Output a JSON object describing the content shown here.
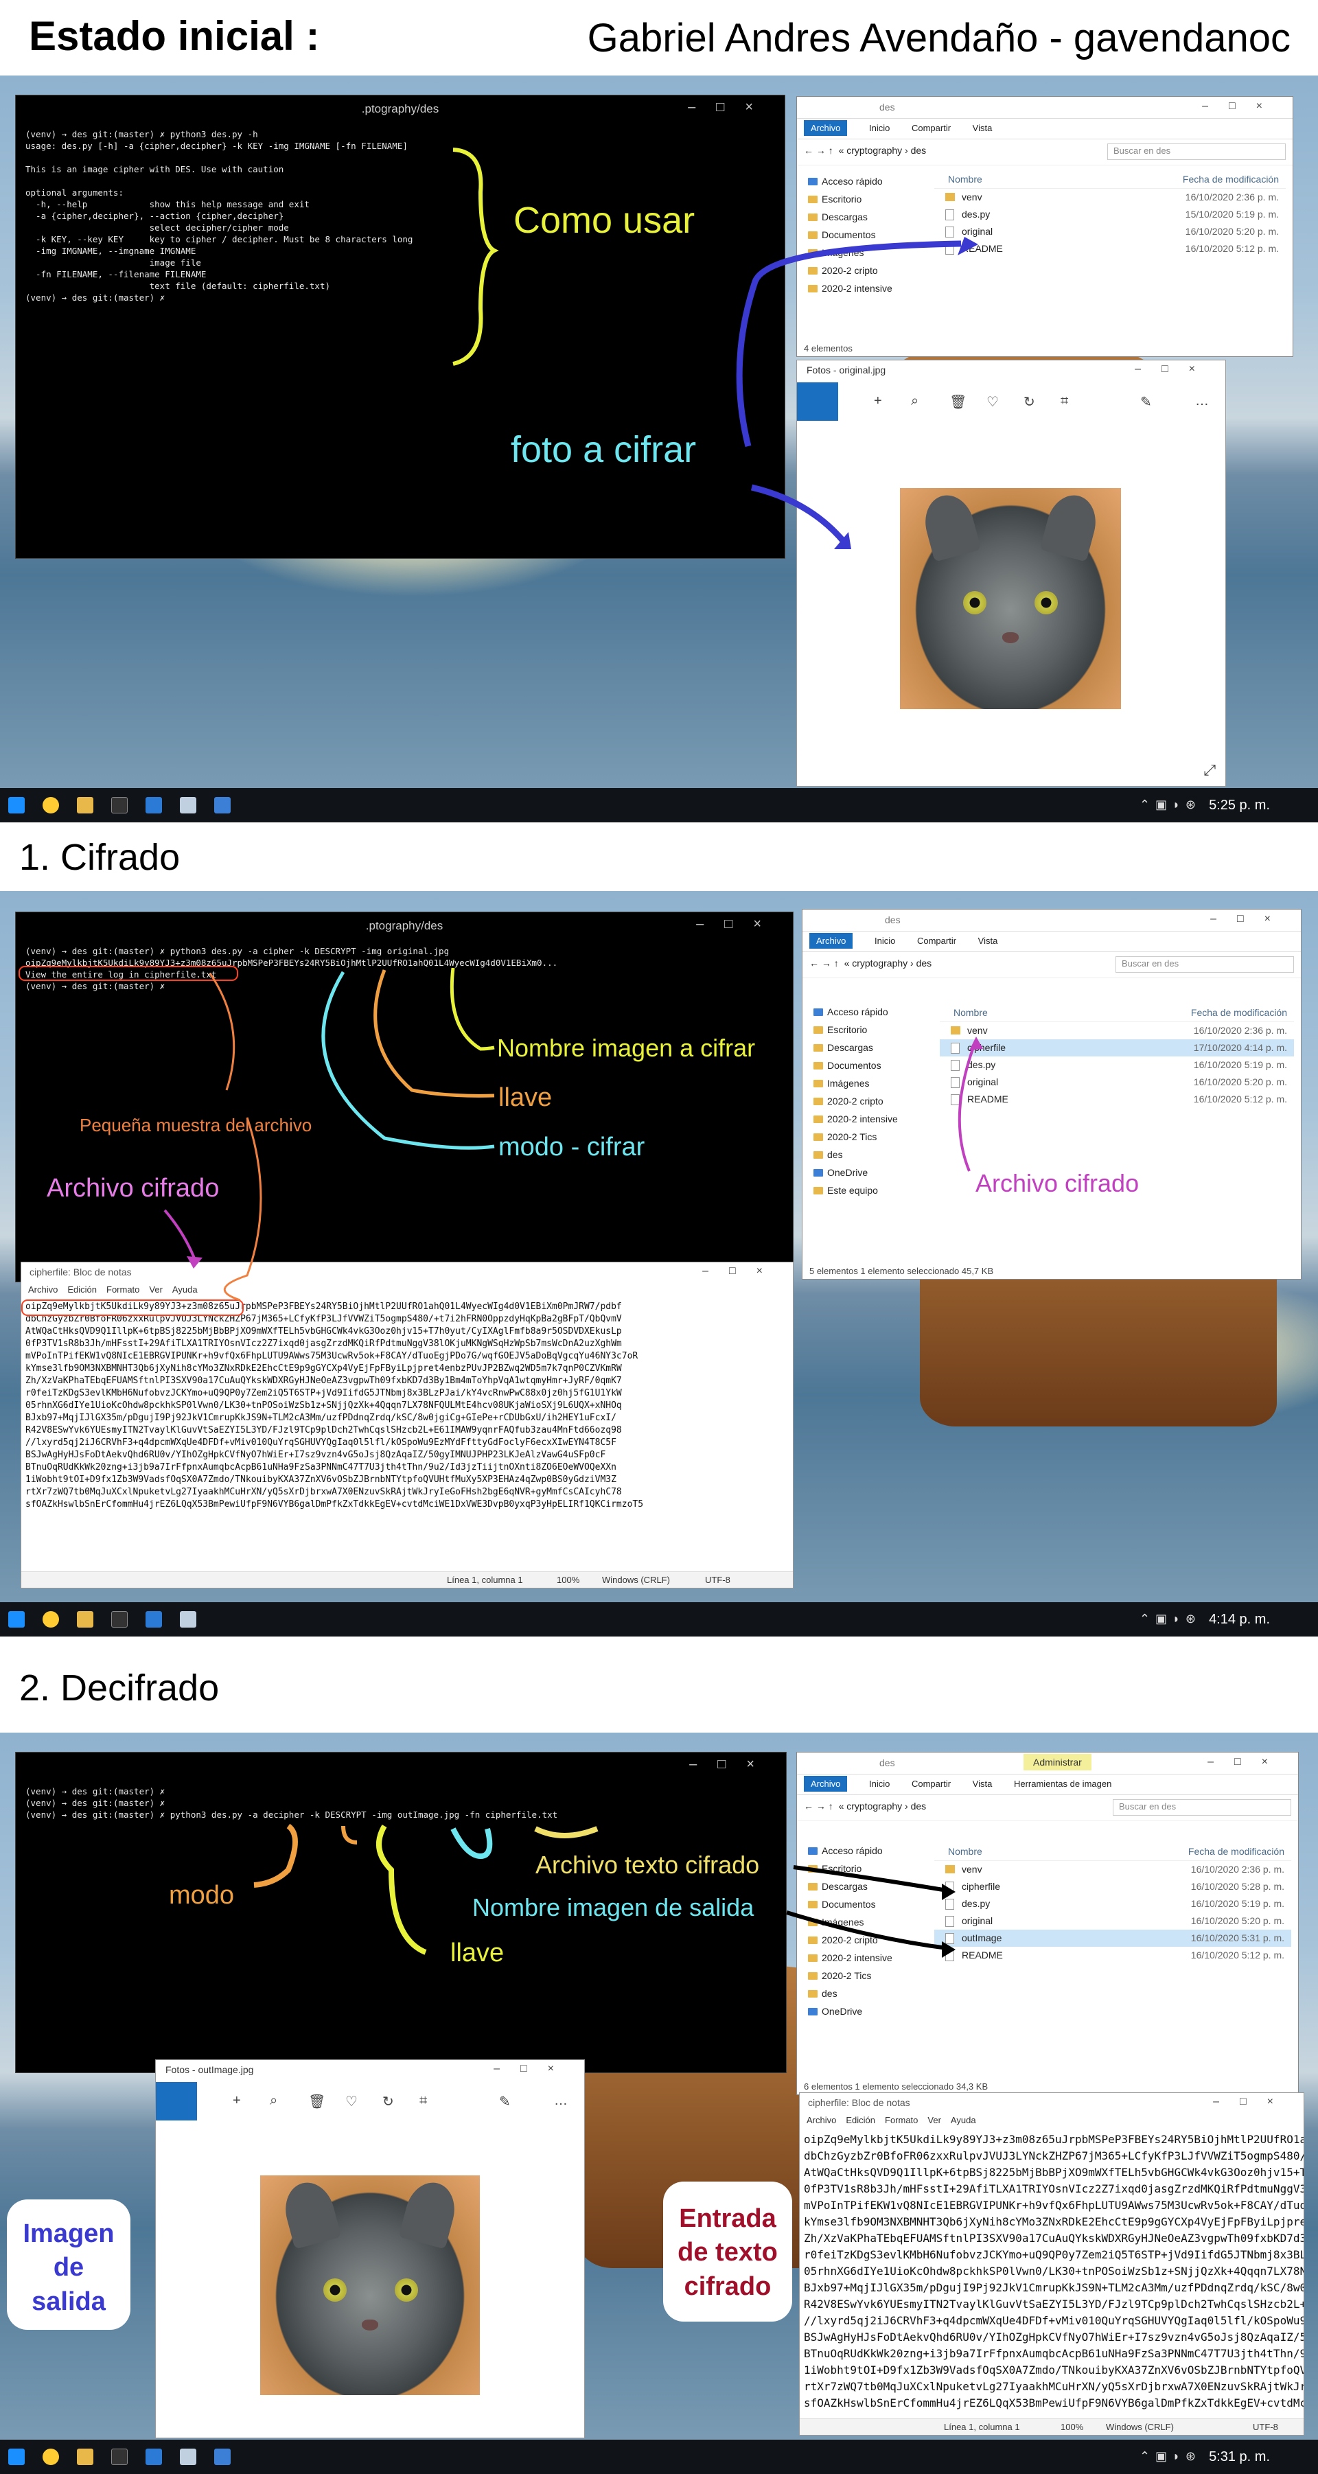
{
  "header": {
    "title": "Estado inicial :",
    "author": "Gabriel Andres Avendaño - gavendanoc"
  },
  "sections": {
    "s1": "1. Cifrado",
    "s2": "2. Decifrado"
  },
  "terminal": {
    "title": ".ptography/des"
  },
  "term1": {
    "l1": "(venv) → des git:(master) ✗ python3 des.py -h",
    "l2": "usage: des.py [-h] -a {cipher,decipher} -k KEY -img IMGNAME [-fn FILENAME]",
    "l3": "",
    "l4": "This is an image cipher with DES. Use with caution",
    "l5": "",
    "l6": "optional arguments:",
    "l7": "  -h, --help            show this help message and exit",
    "l8": "  -a {cipher,decipher}, --action {cipher,decipher}",
    "l9": "                        select decipher/cipher mode",
    "l10": "  -k KEY, --key KEY     key to cipher / decipher. Must be 8 characters long",
    "l11": "  -img IMGNAME, --imgname IMGNAME",
    "l12": "                        image file",
    "l13": "  -fn FILENAME, --filename FILENAME",
    "l14": "                        text file (default: cipherfile.txt)",
    "l15": "(venv) → des git:(master) ✗"
  },
  "term2": {
    "l1": "(venv) → des git:(master) ✗ python3 des.py -a cipher -k DESCRYPT -img original.jpg",
    "l2": "oipZq9eMylkbjtK5UkdiLk9y89YJ3+z3m08z65uJrpbMSPeP3FBEYs24RY5BiOjhMtlP2UUfRO1ahQ01L4WyecWIg4d0V1EBiXm0...",
    "l3": "View the entire log in cipherfile.txt",
    "l4": "(venv) → des git:(master) ✗"
  },
  "term3": {
    "l1": "(venv) → des git:(master) ✗",
    "l2": "(venv) → des git:(master) ✗",
    "l3": "(venv) → des git:(master) ✗ python3 des.py -a decipher -k DESCRYPT -img outImage.jpg -fn cipherfile.txt"
  },
  "explorer": {
    "title": "des",
    "tabs": [
      "Archivo",
      "Inicio",
      "Compartir",
      "Vista"
    ],
    "tools_tab": "Herramientas de imagen",
    "manage_tab": "Administrar",
    "path": "« cryptography › des",
    "search": "Buscar en des",
    "col_name": "Nombre",
    "col_date": "Fecha de modificación",
    "nav": [
      "Acceso rápido",
      "Escritorio",
      "Descargas",
      "Documentos",
      "Imágenes",
      "2020-2 cripto",
      "2020-2 intensive",
      "2020-2 Tics",
      "des",
      "OneDrive",
      "Este equipo"
    ],
    "files1": [
      {
        "n": "venv",
        "d": "16/10/2020 2:36 p. m."
      },
      {
        "n": "des.py",
        "d": "15/10/2020 5:19 p. m."
      },
      {
        "n": "original",
        "d": "16/10/2020 5:20 p. m."
      },
      {
        "n": "README",
        "d": "16/10/2020 5:12 p. m."
      }
    ],
    "status1": "4 elementos",
    "files2": [
      {
        "n": "venv",
        "d": "16/10/2020 2:36 p. m."
      },
      {
        "n": "cipherfile",
        "d": "17/10/2020 4:14 p. m."
      },
      {
        "n": "des.py",
        "d": "16/10/2020 5:19 p. m."
      },
      {
        "n": "original",
        "d": "16/10/2020 5:20 p. m."
      },
      {
        "n": "README",
        "d": "16/10/2020 5:12 p. m."
      }
    ],
    "status2": "5 elementos     1 elemento seleccionado  45,7 KB",
    "files3": [
      {
        "n": "venv",
        "d": "16/10/2020 2:36 p. m."
      },
      {
        "n": "cipherfile",
        "d": "16/10/2020 5:28 p. m."
      },
      {
        "n": "des.py",
        "d": "16/10/2020 5:19 p. m."
      },
      {
        "n": "original",
        "d": "16/10/2020 5:20 p. m."
      },
      {
        "n": "outImage",
        "d": "16/10/2020 5:31 p. m."
      },
      {
        "n": "README",
        "d": "16/10/2020 5:12 p. m."
      }
    ],
    "status3": "6 elementos     1 elemento seleccionado  34,3 KB"
  },
  "photos": {
    "title1": "Fotos - original.jpg",
    "title2": "Fotos - outImage.jpg"
  },
  "notepad": {
    "title": "cipherfile: Bloc de notas",
    "menu": [
      "Archivo",
      "Edición",
      "Formato",
      "Ver",
      "Ayuda"
    ],
    "lines": [
      "oipZq9eMylkbjtK5UkdiLk9y89YJ3+z3m08z65uJrpbMSPeP3FBEYs24RY5BiOjhMtlP2UUfRO1ahQ01L4WyecWIg4d0V1EBiXm0PmJRW7/pdbf",
      "dbChzGyzbZr0BfoFR06zxxRulpvJVUJ3LYNckZHZP67jM365+LCfyKfP3LJfVVWZiT5ogmpS480/+t7i2hFRN0OppzdyHqKpBa2gBFpT/QbQvmV",
      "AtWQaCtHksQVD9Q1IllpK+6tpBSj8225bMjBbBPjXO9mWXfTELh5vbGHGCWk4vkG3Ooz0hjv15+T7h0yut/CyIXAglFmfb8a9r5OSDVDXEkusLp",
      "0fP3TV1sR8b3Jh/mHFsstI+29AfiTLXA1TRIYOsnVIcz2Z7ixqd0jasgZrzdMKQiRfPdtmuNggV38lOKjuMKNgWSqHzWpSb7msWcDnA2uzXghWm",
      "mVPoInTPifEKW1vQ8NIcE1EBRGVIPUNKr+h9vfQx6FhpLUTU9AWws75M3UcwRv5ok+F8CAY/dTuoEgjPDo7G/wqfGOEJV5aDoBqVgcqYu46NY3c7oR",
      "kYmse3lfb9OM3NXBMNHT3Qb6jXyNih8cYMo3ZNxRDkE2EhcCtE9p9gGYCXp4VyEjFpFByiLpjpret4enbzPUvJP2BZwq2WD5m7k7qnP0CZVKmRW",
      "Zh/XzVaKPhaTEbqEFUAMSftnlPI3SXV90a17CuAuQYkskWDXRGyHJNeOeAZ3vgpwTh09fxbKD7d3By1Bm4mToYhpVqA1wtqmyHmr+JyRF/0qmK7",
      "r0feiTzKDgS3evlKMbH6NufobvzJCKYmo+uQ9QP0y7Zem2iQ5T6STP+jVd9IifdG5JTNbmj8x3BLzPJai/kY4vcRnwPwC88x0jz0hj5fG1U1YkW",
      "05rhnXG6dIYe1UioKcOhdw8pckhkSP0lVwn0/LK30+tnPOSoiWzSb1z+SNjjQzXk+4Qqqn7LX78NFQULMtE4hcv08UKjaWioSXj9L6UQX+xNHOq",
      "BJxb97+MqjIJlGX35m/pDgujI9Pj92JkV1CmrupKkJS9N+TLM2cA3Mm/uzfPDdnqZrdq/kSC/8w0jgiCg+GIePe+rCDUbGxU/ih2HEY1uFcxI/",
      "R42V8ESwYvk6YUEsmyITN2TvaylKlGuvVtSaEZYI5L3YD/FJzl9TCp9plDch2TwhCqslSHzcb2L+E61IMAW9yqnrFAQfub3zau4MnFtd66ozq98",
      "//lxyrd5qj2iJ6CRVhF3+q4dpcmWXqUe4DFDf+vMiv010QuYrqSGHUVYQgIaq0l5lfl/kOSpoWu9EzMYdFfttyGdFoclyF6ecxXIwEYN4T8C5F",
      "BSJwAgHyHJsFoDtAekvQhd6RU0v/YIhOZgHpkCVfNyO7hWiEr+I7sz9vzn4vG5oJsj8QzAqaIZ/50gyIMNUJPHP23LKJeAlzVawG4uSFp0cF",
      "BTnuOqRUdKkWk20zng+i3jb9a7IrFfpnxAumqbcAcpB61uNHa9FzSa3PNNmC47T7U3jth4tThn/9u2/Id3jzTiijtnOXnti8ZO6EOeWVOQeXXn",
      "1iWobht9tOI+D9fx1Zb3W9VadsfOqSX0A7Zmdo/TNkouibyKXA37ZnXV6vOSbZJBrnbNTYtpfoQVUHtfMuXy5XP3EHAz4qZwp0BS0yGdziVM3Z",
      "rtXr7zWQ7tb0MqJuXCxlNpuketvLg27IyaakhMCuHrXN/yQ5sXrDjbrxwA7X0ENzuvSkRAjtWkJryIeGoFHsh2bgE6qNVR+gyMmfCsCAIcyhC78",
      "sfOAZkHswlbSnErCfommHu4jrEZ6LQqX53BmPewiUfpF9N6VYB6galDmPfkZxTdkkEgEV+cvtdMciWE1DxVWE3DvpB0yxqP3yHpELIRf1QKCirmzoT5"
    ]
  },
  "status_bar": {
    "pos": "Línea 1, columna 1",
    "zoom": "100%",
    "eol": "Windows (CRLF)",
    "enc": "UTF-8"
  },
  "taskbar": {
    "t1": "5:25 p. m.",
    "t2": "4:14 p. m.",
    "t3": "5:31 p. m."
  },
  "annotations": {
    "como_usar": "Como usar",
    "foto": "foto a cifrar",
    "nombre_img": "Nombre imagen a cifrar",
    "llave": "llave",
    "modo_cifrar": "modo - cifrar",
    "muestra": "Pequeña muestra del archivo",
    "archivo_cifrado": "Archivo cifrado",
    "archivo_cifrado2": "Archivo cifrado",
    "modo": "modo",
    "archivo_texto": "Archivo texto cifrado",
    "nombre_salida": "Nombre imagen de salida",
    "llave2": "llave",
    "imagen_salida": "Imagen de salida",
    "entrada": "Entrada de texto cifrado"
  },
  "colors": {
    "yellow": "#e8f23a",
    "cyan": "#6ee6f0",
    "orange": "#f0a040",
    "magenta": "#c040c0",
    "blue": "#3a3ad0",
    "maroon": "#a0102a"
  }
}
